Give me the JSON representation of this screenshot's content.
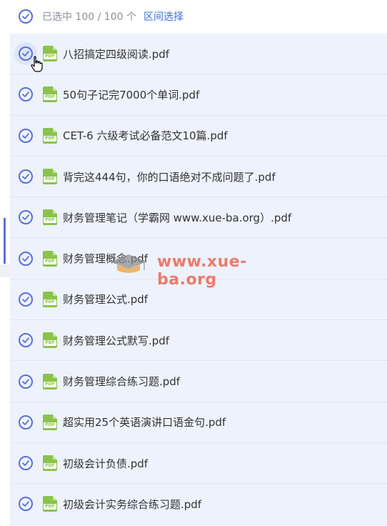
{
  "header": {
    "count_text": "已选中 100 / 100 个",
    "range_select_label": "区间选择"
  },
  "files": [
    {
      "name": "八招搞定四级阅读.pdf"
    },
    {
      "name": "50句子记完7000个单词.pdf"
    },
    {
      "name": "CET-6 六级考试必备范文10篇.pdf"
    },
    {
      "name": "背完这444句，你的口语绝对不成问题了.pdf"
    },
    {
      "name": "财务管理笔记（学霸网 www.xue-ba.org）.pdf"
    },
    {
      "name": "财务管理概念.pdf"
    },
    {
      "name": "财务管理公式.pdf"
    },
    {
      "name": "财务管理公式默写.pdf"
    },
    {
      "name": "财务管理综合练习题.pdf"
    },
    {
      "name": "超实用25个英语演讲口语金句.pdf"
    },
    {
      "name": "初级会计负债.pdf"
    },
    {
      "name": "初级会计实务综合练习题.pdf"
    }
  ],
  "icons": {
    "pdf_tag": "PDF",
    "check_color": "#5b6fd6",
    "pdf_color": "#8bc34a"
  },
  "watermark": {
    "text": "www.xue-ba.org"
  }
}
